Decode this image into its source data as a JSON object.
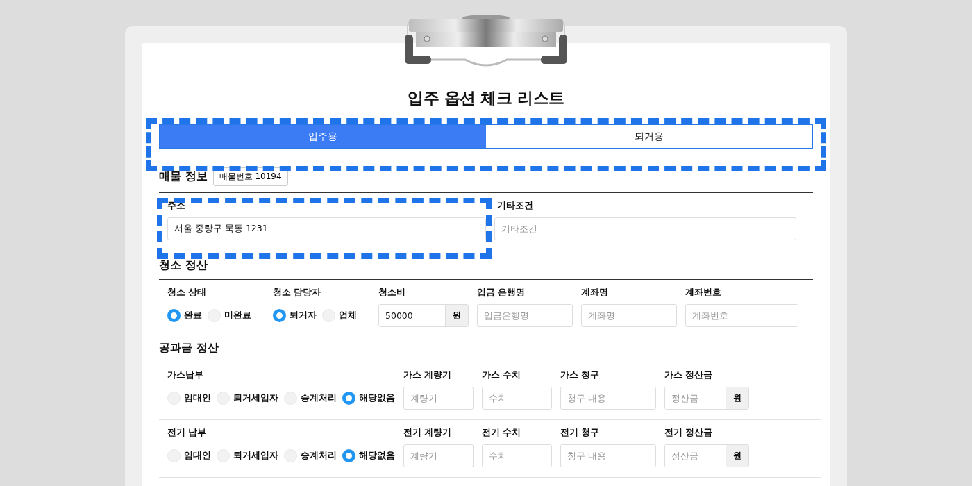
{
  "title": "입주 옵션 체크 리스트",
  "tabs": [
    {
      "label": "입주용",
      "selected": true
    },
    {
      "label": "퇴거용",
      "selected": false
    }
  ],
  "sections": [
    {
      "title": "매물 정보",
      "badge": "매물번호 10194",
      "rows": [
        {
          "fields": [
            {
              "kind": "text",
              "label": "주소",
              "value": "서울 중랑구 묵동 1231"
            },
            {
              "kind": "text",
              "label": "기타조건",
              "placeholder": "기타조건"
            }
          ]
        }
      ]
    },
    {
      "title": "청소 정산",
      "rows": [
        {
          "fields": [
            {
              "kind": "radio",
              "label": "청소 상태",
              "options": [
                {
                  "label": "완료",
                  "selected": true
                },
                {
                  "label": "미완료",
                  "selected": false
                }
              ]
            },
            {
              "kind": "radio",
              "label": "청소 담당자",
              "options": [
                {
                  "label": "퇴거자",
                  "selected": true
                },
                {
                  "label": "업체",
                  "selected": false
                }
              ]
            },
            {
              "kind": "unit",
              "label": "청소비",
              "value": "50000",
              "unit": "원"
            },
            {
              "kind": "text",
              "label": "입금 은행명",
              "placeholder": "입금은행명"
            },
            {
              "kind": "text",
              "label": "계좌명",
              "placeholder": "계좌명"
            },
            {
              "kind": "text",
              "label": "계좌번호",
              "placeholder": "계좌번호"
            }
          ]
        }
      ]
    },
    {
      "title": "공과금 정산",
      "rows": [
        {
          "fields": [
            {
              "kind": "radio",
              "label": "가스납부",
              "options": [
                {
                  "label": "임대인",
                  "selected": false
                },
                {
                  "label": "퇴거세입자",
                  "selected": false
                },
                {
                  "label": "승계처리",
                  "selected": false
                },
                {
                  "label": "해당없음",
                  "selected": true
                }
              ]
            },
            {
              "kind": "text",
              "label": "가스 계량기",
              "placeholder": "계량기"
            },
            {
              "kind": "text",
              "label": "가스 수치",
              "placeholder": "수치"
            },
            {
              "kind": "text",
              "label": "가스 청구",
              "placeholder": "청구 내용"
            },
            {
              "kind": "unit",
              "label": "가스 정산금",
              "placeholder": "정산금",
              "unit": "원"
            }
          ]
        },
        {
          "fields": [
            {
              "kind": "radio",
              "label": "전기 납부",
              "options": [
                {
                  "label": "임대인",
                  "selected": false
                },
                {
                  "label": "퇴거세입자",
                  "selected": false
                },
                {
                  "label": "승계처리",
                  "selected": false
                },
                {
                  "label": "해당없음",
                  "selected": true
                }
              ]
            },
            {
              "kind": "text",
              "label": "전기 계량기",
              "placeholder": "계량기"
            },
            {
              "kind": "text",
              "label": "전기 수치",
              "placeholder": "수치"
            },
            {
              "kind": "text",
              "label": "전기 청구",
              "placeholder": "청구 내용"
            },
            {
              "kind": "unit",
              "label": "전기 정산금",
              "placeholder": "정산금",
              "unit": "원"
            }
          ]
        }
      ]
    }
  ]
}
